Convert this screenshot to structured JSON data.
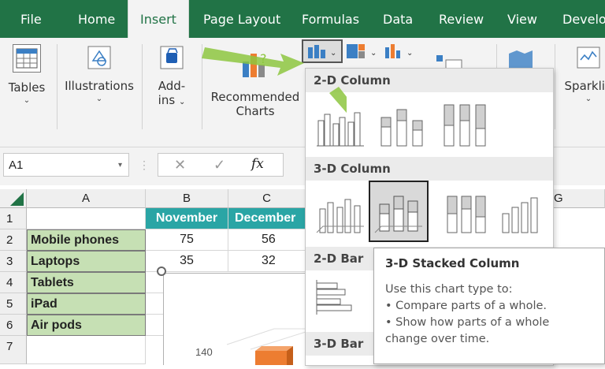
{
  "ribbon_tabs": [
    "File",
    "Home",
    "Insert",
    "Page Layout",
    "Formulas",
    "Data",
    "Review",
    "View",
    "Develop"
  ],
  "active_tab": "Insert",
  "ribbon_groups": {
    "tables": "Tables",
    "illustrations": "Illustrations",
    "addins_1": "Add-",
    "addins_2": "ins",
    "recommended_1": "Recommended",
    "recommended_2": "Charts",
    "sparklines": "Sparklin"
  },
  "formula_bar": {
    "name_box": "A1",
    "fx": "fx"
  },
  "columns": [
    "A",
    "B",
    "C",
    "G"
  ],
  "rows": [
    "1",
    "2",
    "3",
    "4",
    "5",
    "6",
    "7"
  ],
  "table": {
    "headers": [
      "November",
      "December"
    ],
    "rows": [
      {
        "label": "Mobile phones",
        "values": [
          "75",
          "56"
        ]
      },
      {
        "label": "Laptops",
        "values": [
          "35",
          "32"
        ]
      },
      {
        "label": "Tablets",
        "values": []
      },
      {
        "label": "iPad",
        "values": []
      },
      {
        "label": "Air pods",
        "values": []
      }
    ]
  },
  "chart_axis_label": "140",
  "dropdown": {
    "sections": [
      "2-D Column",
      "3-D Column",
      "2-D Bar",
      "3-D Bar"
    ],
    "selected": "3-D Stacked Column"
  },
  "tooltip": {
    "title": "3-D Stacked Column",
    "intro": "Use this chart type to:",
    "bullet1": "• Compare parts of a whole.",
    "bullet2": "• Show how parts of a whole",
    "bullet3": "change over time."
  },
  "colors": {
    "excel_green": "#217346",
    "header_teal": "#2aa5a5",
    "label_green": "#c6e0b4",
    "arrow_green": "#8dc63f",
    "bar_orange": "#ed7d31"
  }
}
